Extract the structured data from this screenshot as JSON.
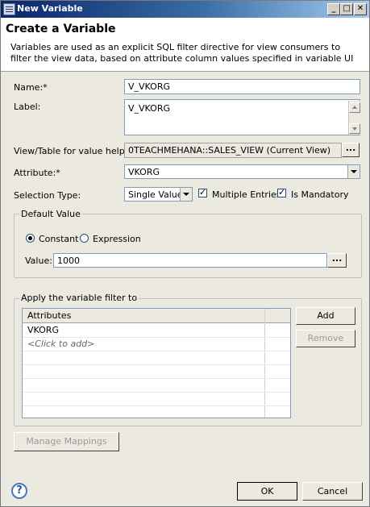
{
  "window": {
    "title": "New Variable",
    "minimize": "_",
    "maximize": "□",
    "close": "✕"
  },
  "header": {
    "title": "Create a Variable",
    "description": "Variables are used as an explicit SQL filter directive for view consumers to filter the view data, based on attribute column values specified in variable UI"
  },
  "form": {
    "name_label": "Name:*",
    "name_value": "V_VKORG",
    "label_label": "Label:",
    "label_value": "V_VKORG",
    "view_label": "View/Table for value help:*",
    "view_value": "0TEACHMEHANA::SALES_VIEW (Current View)",
    "browse": "...",
    "attribute_label": "Attribute:*",
    "attribute_value": "VKORG",
    "selection_type_label": "Selection Type:",
    "selection_type_value": "Single Value",
    "multiple_entries_label": "Multiple Entries",
    "is_mandatory_label": "Is Mandatory"
  },
  "default_value": {
    "group_title": "Default Value",
    "constant_label": "Constant",
    "expression_label": "Expression",
    "value_label": "Value:",
    "value": "1000",
    "browse": "..."
  },
  "filter": {
    "group_title": "Apply the variable filter to",
    "column_header": "Attributes",
    "rows": [
      "VKORG",
      "<Click to add>"
    ],
    "add_label": "Add",
    "remove_label": "Remove"
  },
  "footer": {
    "manage_mappings_label": "Manage Mappings",
    "help": "?",
    "ok_label": "OK",
    "cancel_label": "Cancel"
  }
}
